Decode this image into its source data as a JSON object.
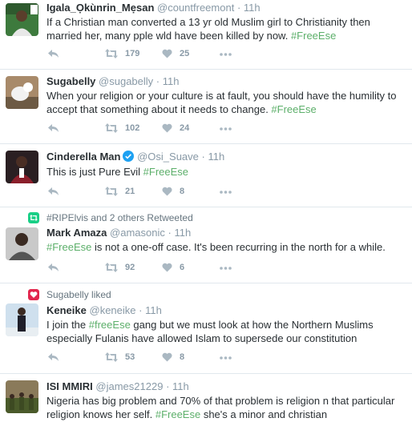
{
  "tweets": [
    {
      "name": "Igala_Ọkùnrin_Mẹsan",
      "handle": "@countfreemont",
      "dot": "·",
      "time": "11h",
      "text_before": "If a Christian man converted a 13 yr old Muslim girl to Christianity then married her, many pple wld have been killed by now. ",
      "hashtag": "#FreeEse",
      "text_after": "",
      "retweets": "179",
      "likes": "25"
    },
    {
      "name": "Sugabelly",
      "handle": "@sugabelly",
      "dot": "·",
      "time": "11h",
      "text_before": "When your religion or your culture is at fault, you should have the humility to accept that something about it needs to change. ",
      "hashtag": "#FreeEse",
      "text_after": "",
      "retweets": "102",
      "likes": "24"
    },
    {
      "name": "Cinderella Man",
      "handle": "@Osi_Suave",
      "dot": "·",
      "time": "11h",
      "verified": true,
      "text_before": "This is just Pure Evil ",
      "hashtag": "#FreeEse",
      "text_after": "",
      "retweets": "21",
      "likes": "8"
    },
    {
      "context": "#RIPElvis and 2 others Retweeted",
      "name": "Mark Amaza",
      "handle": "@amasonic",
      "dot": "·",
      "time": "11h",
      "text_before": "",
      "hashtag": "#FreeEse",
      "text_after": " is not a one-off case. It's been recurring in the north for a while.",
      "retweets": "92",
      "likes": "6"
    },
    {
      "context": "Sugabelly liked",
      "name": "Keneike",
      "handle": "@keneike",
      "dot": "·",
      "time": "11h",
      "text_before": "I join the ",
      "hashtag": "#freeEse",
      "text_after": " gang but we must look at how the Northern Muslims especially Fulanis have allowed Islam to supersede our constitution",
      "retweets": "53",
      "likes": "8"
    },
    {
      "name": "ISI MMIRI",
      "handle": "@james21229",
      "dot": "·",
      "time": "11h",
      "text_before": "Nigeria has big problem and 70% of that problem is religion n that particular religion knows her self. ",
      "hashtag": "#FreeEse",
      "text_after": " she's a minor and christian"
    }
  ],
  "icons": {
    "reply": "reply-icon",
    "retweet": "retweet-icon",
    "like": "heart-icon",
    "more": "more-icon",
    "verified": "verified-badge-icon",
    "context_retweet": "retweet-context-icon",
    "context_like": "heart-context-icon"
  },
  "colors": {
    "hashtag": "#5caf6a",
    "retweet_context": "#19cf86",
    "like_context": "#e2264d",
    "verified": "#1da1f2"
  }
}
